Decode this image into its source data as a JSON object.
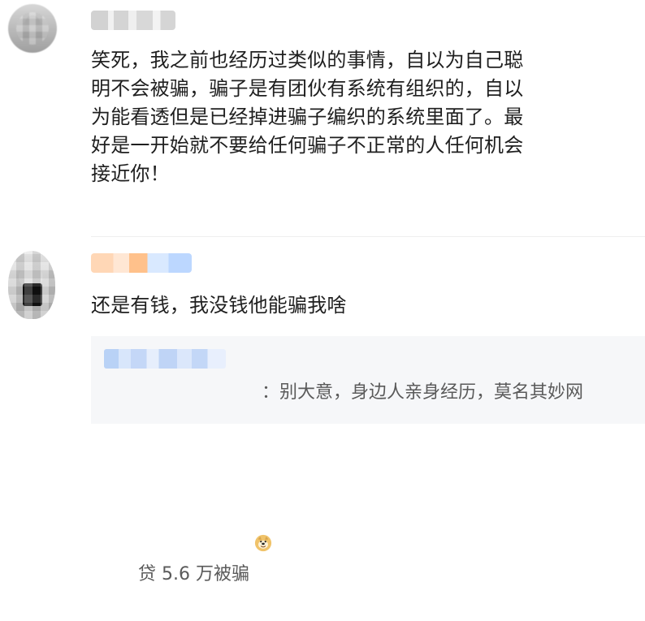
{
  "comments": [
    {
      "text": "笑死，我之前也经历过类似的事情，自以为自己聪\n明不会被骗，骗子是有团伙有系统有组织的，自以\n为能看透但是已经掉进骗子编织的系统里面了。最\n好是一开始就不要给任何骗子不正常的人任何机会\n接近你！"
    },
    {
      "text": "还是有钱，我没钱他能骗我啥"
    }
  ],
  "reply": {
    "text_line_1": "：别大意，身边人亲身经历，莫名其妙网",
    "text_line_2": "贷 5.6 万被骗",
    "emoji_icon": "doge-icon"
  }
}
